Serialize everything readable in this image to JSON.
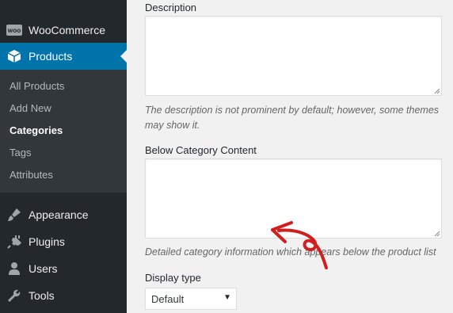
{
  "sidebar": {
    "woocommerce": {
      "label": "WooCommerce",
      "icon": "woocommerce-icon",
      "icon_text": "WOO"
    },
    "products": {
      "label": "Products",
      "icon": "products-icon"
    },
    "submenu": [
      {
        "label": "All Products"
      },
      {
        "label": "Add New"
      },
      {
        "label": "Categories",
        "current": true
      },
      {
        "label": "Tags"
      },
      {
        "label": "Attributes"
      }
    ],
    "appearance": {
      "label": "Appearance",
      "icon": "paintbrush-icon"
    },
    "plugins": {
      "label": "Plugins",
      "icon": "plug-icon"
    },
    "users": {
      "label": "Users",
      "icon": "user-icon"
    },
    "tools": {
      "label": "Tools",
      "icon": "wrench-icon"
    }
  },
  "form": {
    "description": {
      "label": "Description",
      "value": "",
      "help": "The description is not prominent by default; however, some themes may show it."
    },
    "below_content": {
      "label": "Below Category Content",
      "value": "",
      "help": "Detailed category information which appears below the product list"
    },
    "display_type": {
      "label": "Display type",
      "selected": "Default"
    }
  },
  "colors": {
    "sidebar_bg": "#23282d",
    "submenu_bg": "#32373c",
    "active_bg": "#0073aa",
    "annotation_arrow": "#d01f1f"
  }
}
